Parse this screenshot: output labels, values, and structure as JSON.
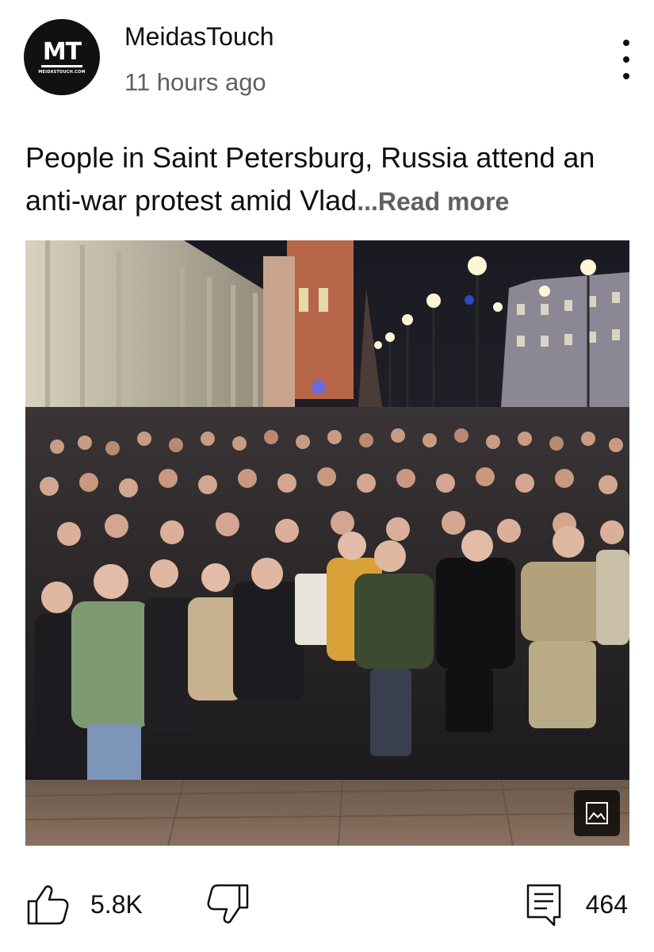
{
  "post": {
    "channel_name": "MeidasTouch",
    "time_ago": "11 hours ago",
    "avatar": {
      "monogram": "MT",
      "url_text": "MEIDASTOUCH.COM"
    },
    "text": "People in Saint Petersburg, Russia attend an anti-war protest amid Vlad",
    "ellipsis": "...",
    "read_more_label": "Read more",
    "image": {
      "description_icon": "image-icon"
    }
  },
  "actions": {
    "like_count": "5.8K",
    "comment_count": "464",
    "like_icon": "thumbs-up-icon",
    "dislike_icon": "thumbs-down-icon",
    "comment_icon": "comment-icon"
  },
  "colors": {
    "text_primary": "#0f0f0f",
    "text_secondary": "#606060",
    "background": "#ffffff"
  }
}
